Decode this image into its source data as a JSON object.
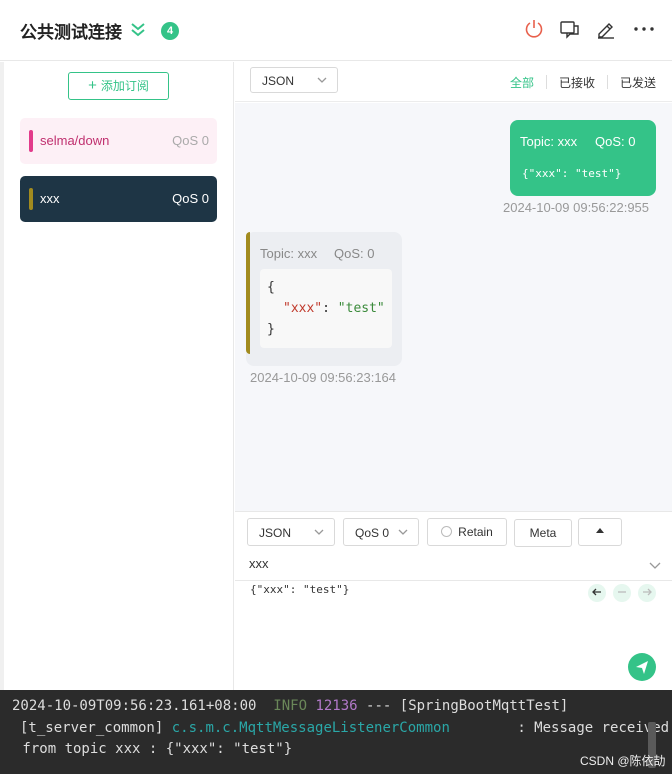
{
  "header": {
    "title": "公共测试连接",
    "badge_count": "4"
  },
  "sidebar": {
    "add_subscription_label": "添加订阅",
    "subscriptions": [
      {
        "topic": "selma/down",
        "qos": "QoS 0",
        "color": "#e23b8b",
        "selected": false
      },
      {
        "topic": "xxx",
        "qos": "QoS 0",
        "color": "#a28b1f",
        "selected": true
      }
    ]
  },
  "toolbar": {
    "format_select": "JSON",
    "filters": [
      "全部",
      "已接收",
      "已发送"
    ]
  },
  "messages": {
    "sent": {
      "topic": "Topic: xxx",
      "qos": "QoS: 0",
      "payload": "{\"xxx\": \"test\"}",
      "time": "2024-10-09 09:56:22:955"
    },
    "received": {
      "topic": "Topic: xxx",
      "qos": "QoS: 0",
      "payload_open": "{",
      "payload_key": "\"xxx\"",
      "payload_sep": ": ",
      "payload_value": "\"test\"",
      "payload_close": "}",
      "time": "2024-10-09 09:56:23:164"
    }
  },
  "composer": {
    "format_select": "JSON",
    "qos_select": "QoS 0",
    "retain_label": "Retain",
    "meta_label": "Meta",
    "topic_value": "xxx",
    "payload_value": "{\"xxx\": \"test\"}"
  },
  "terminal": {
    "line1_a": "2024-10-09T09:56:23.161+08:00",
    "line1_level": "INFO",
    "line1_pid": "12136",
    "line1_b": "--- [SpringBootMqttTest]",
    "line2_a": "[t_server_common]",
    "line2_class": "c.s.m.c.MqttMessageListenerCommon",
    "line2_b": ": Message received",
    "line3": " from topic xxx : {\"xxx\": \"test\"}",
    "watermark": "CSDN @陈依劼"
  },
  "colors": {
    "accent": "#34c388",
    "terminal_bg": "#2b2b2b",
    "info_green": "#6a8759",
    "pid_purple": "#b179c8",
    "class_teal": "#2aa7a7"
  }
}
